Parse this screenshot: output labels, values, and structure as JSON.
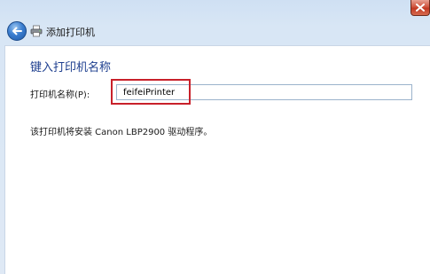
{
  "window": {
    "title": "添加打印机"
  },
  "icons": {
    "close": "close-icon",
    "back": "back-arrow-icon",
    "printer": "printer-icon"
  },
  "page": {
    "heading": "键入打印机名称",
    "printer_name_label": "打印机名称(P):",
    "printer_name_value": "feifeiPrinter",
    "driver_info": "该打印机将安装 Canon LBP2900 驱动程序。"
  },
  "colors": {
    "heading": "#1e3f8f",
    "highlight": "#c8202a",
    "close_button": "#c23a24"
  }
}
